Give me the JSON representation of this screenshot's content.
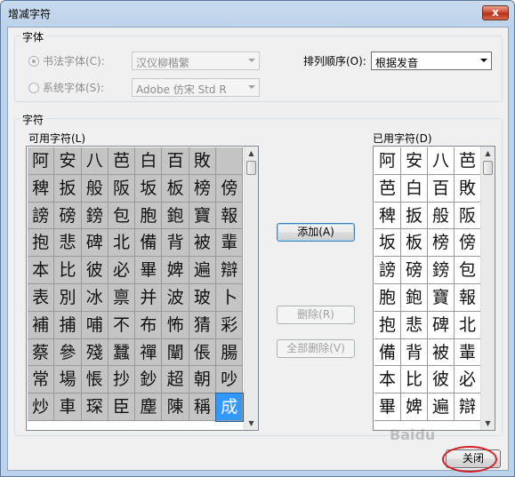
{
  "window": {
    "title": "增减字符",
    "close_glyph": "x"
  },
  "font_group": {
    "label": "字体",
    "calligraphy_radio": "书法字体(C):",
    "calligraphy_value": "汉仪柳楷繁",
    "system_radio": "系统字体(S):",
    "system_value": "Adobe 仿宋 Std R",
    "sort_label": "排列顺序(O):",
    "sort_value": "根据发音"
  },
  "char_group": {
    "label": "字符",
    "available_label": "可用字符(L)",
    "used_label": "已用字符(D)"
  },
  "available_chars": [
    [
      "阿",
      "安",
      "八",
      "芭",
      "白",
      "百",
      "敗"
    ],
    [
      "稗",
      "扳",
      "般",
      "阪",
      "坂",
      "板",
      "榜",
      "傍"
    ],
    [
      "謗",
      "磅",
      "鎊",
      "包",
      "胞",
      "鉋",
      "寶",
      "報"
    ],
    [
      "抱",
      "悲",
      "碑",
      "北",
      "備",
      "背",
      "被",
      "輩"
    ],
    [
      "本",
      "比",
      "彼",
      "必",
      "畢",
      "婢",
      "遍",
      "辯"
    ],
    [
      "表",
      "別",
      "冰",
      "禀",
      "并",
      "波",
      "玻",
      "卜"
    ],
    [
      "補",
      "捕",
      "哺",
      "不",
      "布",
      "怖",
      "猜",
      "彩"
    ],
    [
      "蔡",
      "參",
      "殘",
      "蠶",
      "禪",
      "闡",
      "倀",
      "腸"
    ],
    [
      "常",
      "場",
      "悵",
      "抄",
      "鈔",
      "超",
      "朝",
      "吵"
    ],
    [
      "炒",
      "車",
      "琛",
      "臣",
      "塵",
      "陳",
      "稱",
      "成"
    ]
  ],
  "used_chars": [
    [
      "阿",
      "安",
      "八",
      "芭"
    ],
    [
      "芭",
      "白",
      "百",
      "敗"
    ],
    [
      "稗",
      "扳",
      "般",
      "阪"
    ],
    [
      "坂",
      "板",
      "榜",
      "傍"
    ],
    [
      "謗",
      "磅",
      "鎊",
      "包"
    ],
    [
      "胞",
      "鉋",
      "寶",
      "報"
    ],
    [
      "抱",
      "悲",
      "碑",
      "北"
    ],
    [
      "備",
      "背",
      "被",
      "輩"
    ],
    [
      "本",
      "比",
      "彼",
      "必"
    ],
    [
      "畢",
      "婢",
      "遍",
      "辯"
    ]
  ],
  "buttons": {
    "add": "添加(A)",
    "delete": "删除(R)",
    "delete_all": "全部删除(V)",
    "close": "关闭"
  },
  "scroll_arrows": {
    "up": "▲",
    "down": "▼"
  },
  "watermark": "Baidu"
}
